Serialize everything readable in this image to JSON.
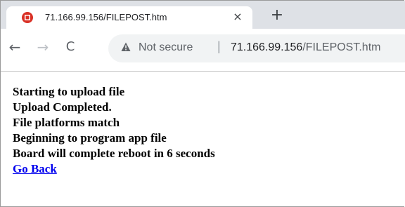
{
  "browser": {
    "tab": {
      "title": "71.166.99.156/FILEPOST.htm",
      "close_glyph": "×",
      "favicon": "red-circle-favicon"
    },
    "new_tab_glyph": "+",
    "nav": {
      "back_glyph": "←",
      "forward_glyph": "→",
      "reload_glyph": "C"
    },
    "address_bar": {
      "security_icon": "warning-triangle-icon",
      "security_label": "Not secure",
      "separator": "|",
      "url_host": "71.166.99.156",
      "url_path": "/FILEPOST.htm"
    }
  },
  "page": {
    "lines": [
      "Starting to upload file",
      "Upload Completed.",
      "File platforms match",
      "Beginning to program app file",
      "Board will complete reboot in 6 seconds"
    ],
    "link": "Go Back"
  },
  "colors": {
    "link": "#0000ee",
    "tabstrip": "#dee1e6",
    "favicon": "#d93025"
  }
}
